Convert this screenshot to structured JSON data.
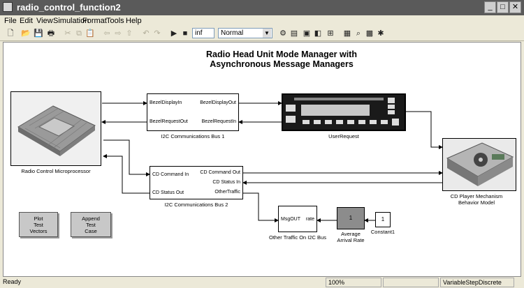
{
  "window": {
    "title": "radio_control_function2"
  },
  "menu": [
    "File",
    "Edit",
    "View",
    "Simulation",
    "Format",
    "Tools",
    "Help"
  ],
  "toolbar": {
    "stop_time": "inf",
    "sim_mode": "Normal"
  },
  "diagram": {
    "title_line1": "Radio Head Unit Mode Manager with",
    "title_line2": "Asynchronous Message Managers",
    "microprocessor_caption": "Radio Control Microprocessor",
    "bus1": {
      "caption": "I2C Communications Bus 1",
      "in1": "BezelDisplayIn",
      "in2": "BezelRequestOut",
      "out1": "BezelDisplayOut",
      "out2": "BezelRequestIn"
    },
    "userrequest_caption": "UserRequest",
    "bus2": {
      "caption": "I2C Communications Bus 2",
      "in1": "CD Command In",
      "in2": "CD Status Out",
      "out1": "CD Command Out",
      "out2": "CD Status In",
      "out3": "OtherTraffic"
    },
    "cdplayer_caption_1": "CD Player Mechanism",
    "cdplayer_caption_2": "Behavior Model",
    "plot_button": [
      "Plot",
      "Test",
      "Vectors"
    ],
    "append_button": [
      "Append",
      "Test",
      "Case"
    ],
    "other_traffic": {
      "caption": "Other Traffic On I2C Bus",
      "in": "MsgOUT",
      "out": "rate"
    },
    "arrival_rate": {
      "value": "1",
      "caption_1": "Average",
      "caption_2": "Arrival Rate"
    },
    "constant": {
      "value": "1",
      "caption": "Constant1"
    }
  },
  "status": {
    "left": "Ready",
    "zoom": "100%",
    "solver": "VariableStepDiscrete"
  }
}
